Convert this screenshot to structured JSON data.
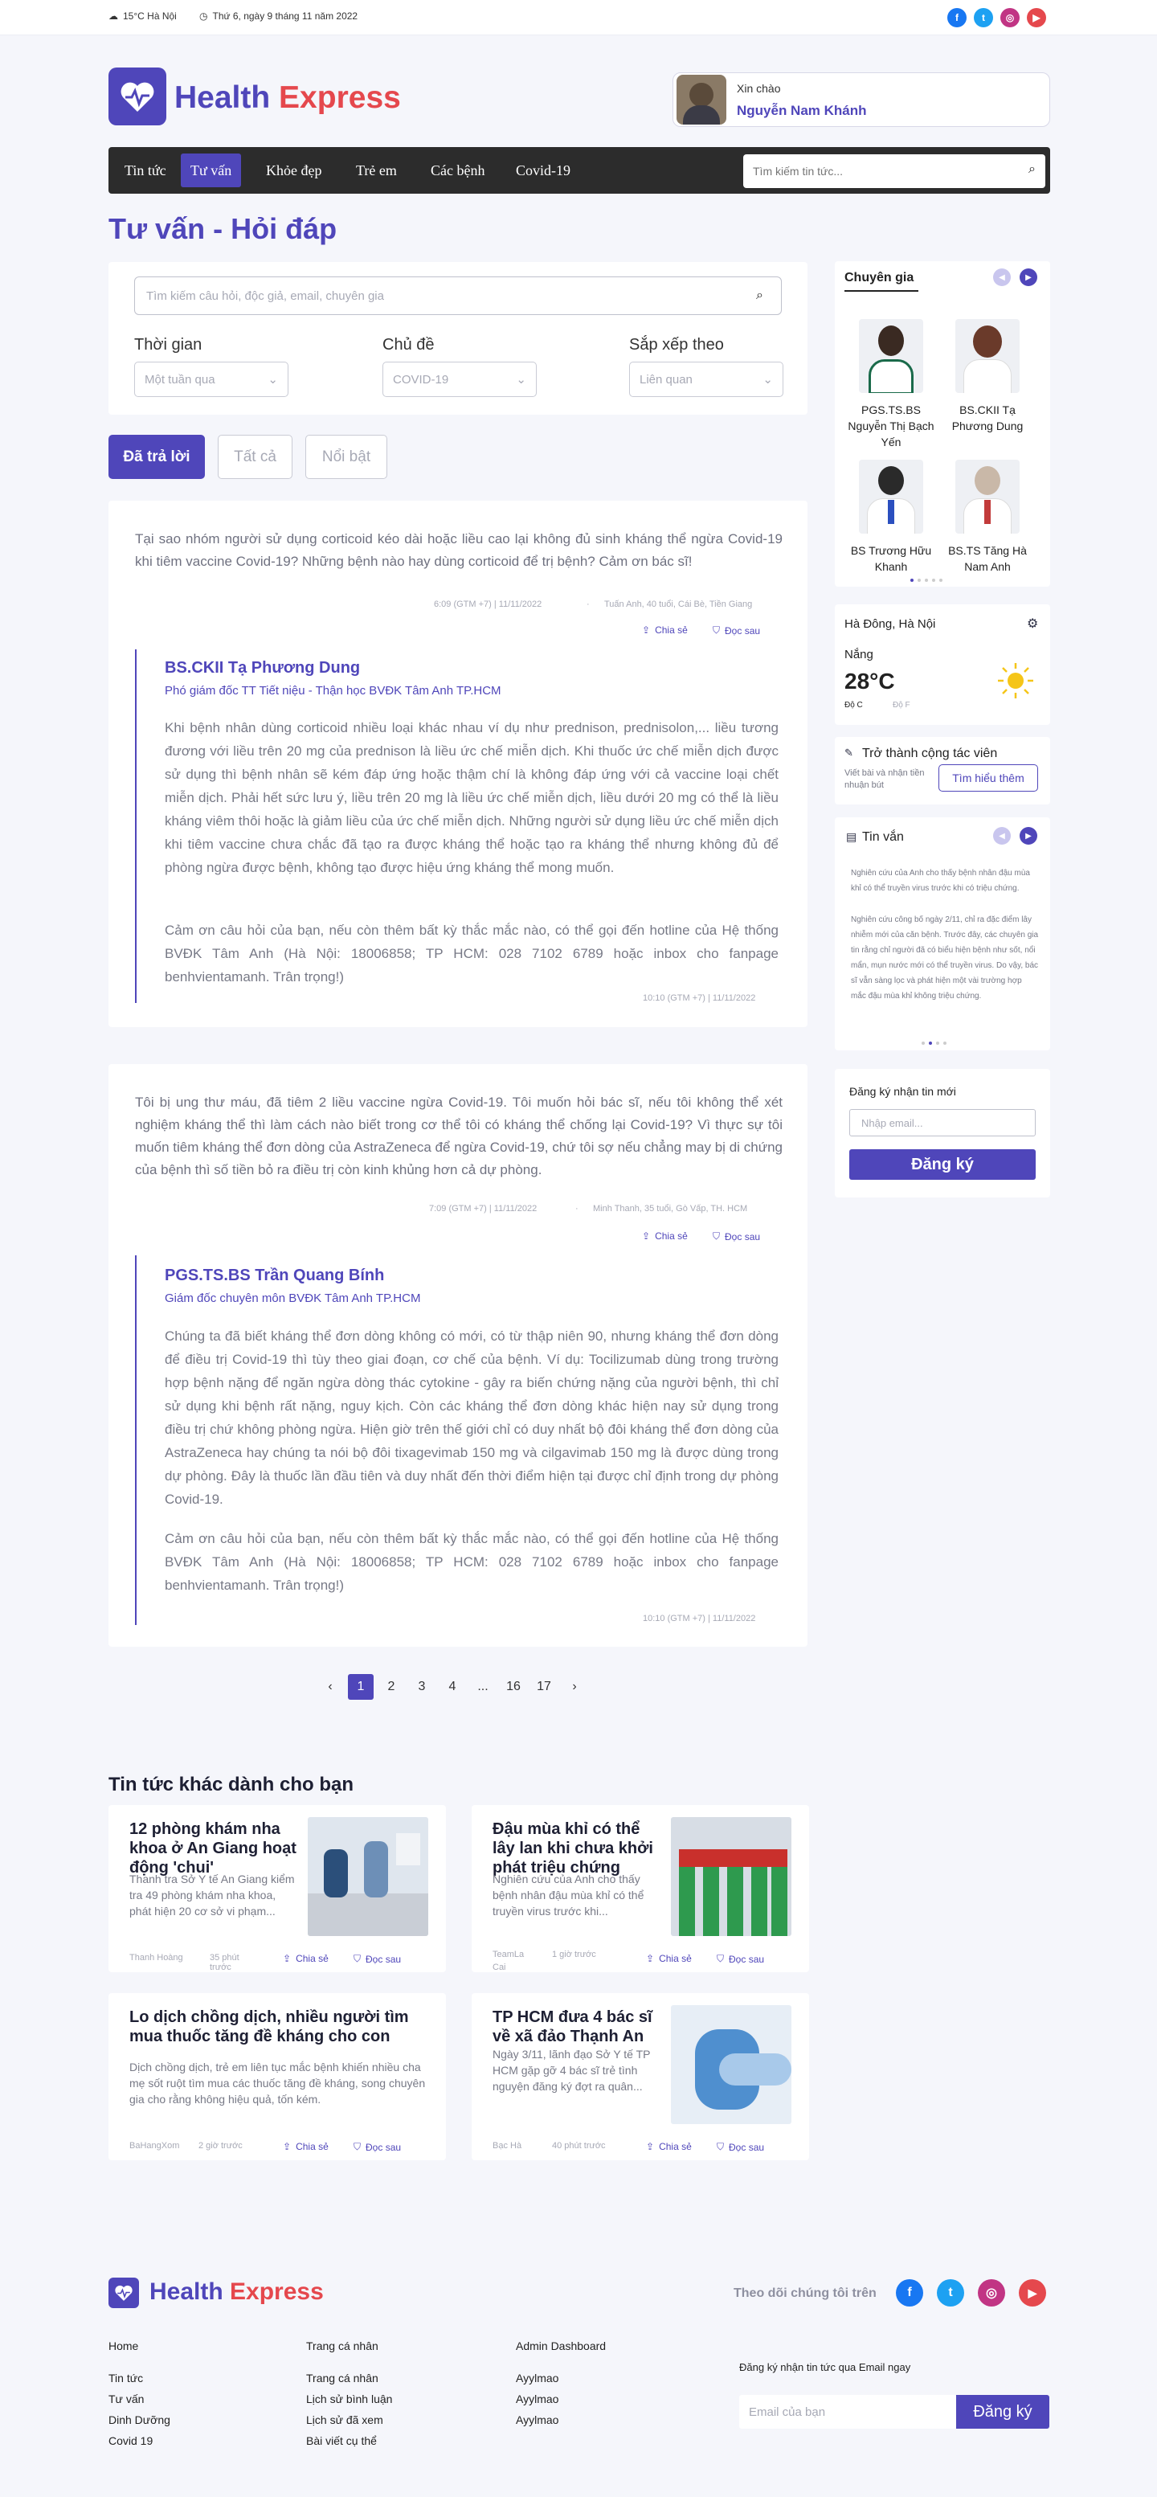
{
  "topbar": {
    "temp": "15°C Hà Nội",
    "date": "Thứ 6, ngày 9 tháng 11 năm 2022",
    "social": [
      "f",
      "t",
      "ig",
      "yt"
    ]
  },
  "brand": {
    "name1": "Health",
    "name2": "Express"
  },
  "greeting": {
    "hello": "Xin chào",
    "user": "Nguyễn Nam Khánh"
  },
  "nav": {
    "items": [
      "Tin tức",
      "Tư vấn",
      "Khỏe đẹp",
      "Trẻ em",
      "Các bệnh",
      "Covid-19"
    ],
    "search_placeholder": "Tìm kiếm tin tức..."
  },
  "page": {
    "title": "Tư vấn - Hỏi đáp"
  },
  "filters": {
    "search_placeholder": "Tìm kiếm câu hỏi, độc giả, email, chuyên gia",
    "time_label": "Thời gian",
    "time_value": "Một tuần qua",
    "topic_label": "Chủ đề",
    "topic_value": "COVID-19",
    "sort_label": "Sắp xếp theo",
    "sort_value": "Liên quan"
  },
  "tabs": [
    "Đã trả lời",
    "Tất cả",
    "Nổi bật"
  ],
  "qa": [
    {
      "question": "Tại sao nhóm người sử dụng corticoid kéo dài hoặc liều cao lại không đủ sinh kháng thể ngừa Covid-19 khi tiêm vaccine Covid-19? Những bệnh nào hay dùng corticoid để trị bệnh? Cảm ơn bác sĩ!",
      "time": "6:09 (GTM +7) | 11/11/2022",
      "asker": "Tuấn Anh, 40 tuổi, Cái Bè, Tiền Giang",
      "share": "Chia sẻ",
      "save": "Đọc sau",
      "doctor": "BS.CKII Tạ Phương Dung",
      "role": "Phó giám đốc TT Tiết niệu - Thận học BVĐK Tâm Anh TP.HCM",
      "answer": "Khi bệnh nhân dùng corticoid nhiều loại khác nhau ví dụ như prednison, prednisolon,... liều tương đương với liều trên 20 mg của prednison là liều ức chế miễn dịch. Khi thuốc ức chế miễn dịch được sử dụng thì bệnh nhân sẽ kém đáp ứng hoặc thậm chí là không đáp ứng với cả vaccine loại chết miễn dịch. Phải hết sức lưu ý, liều trên 20 mg là liều ức chế miễn dịch, liều dưới 20 mg có thể là liều kháng viêm thôi hoặc là giảm liều của ức chế miễn dịch. Những người sử dụng liều ức chế miễn dịch khi tiêm vaccine chưa chắc đã tạo ra được kháng thể hoặc tạo ra kháng thể nhưng không đủ để phòng ngừa được bệnh, không tạo được hiệu ứng kháng thể mong muốn.",
      "thanks": "Cảm ơn câu hỏi của bạn, nếu còn thêm bất kỳ thắc mắc nào, có thể gọi đến hotline của Hệ thống BVĐK Tâm Anh (Hà Nội: 18006858; TP HCM: 028 7102 6789 hoặc inbox cho fanpage benhvientamanh. Trân trọng!)",
      "atime": "10:10 (GTM +7) | 11/11/2022"
    },
    {
      "question": "Tôi bị ung thư máu, đã tiêm 2 liều vaccine ngừa Covid-19. Tôi muốn hỏi bác sĩ, nếu tôi không thể xét nghiệm kháng thể thì làm cách nào biết trong cơ thể tôi có kháng thể chống lại Covid-19? Vì thực sự tôi muốn tiêm kháng thể đơn dòng của AstraZeneca để ngừa Covid-19, chứ tôi sợ nếu chẳng may bị di chứng của bệnh thì số tiền bỏ ra điều trị còn kinh khủng hơn cả dự phòng.",
      "time": "7:09 (GTM +7) | 11/11/2022",
      "asker": "Minh Thanh, 35 tuổi, Gò Vấp, TH. HCM",
      "share": "Chia sẻ",
      "save": "Đọc sau",
      "doctor": "PGS.TS.BS Trần Quang Bính",
      "role": "Giám đốc chuyên môn BVĐK Tâm Anh TP.HCM",
      "answer": "Chúng ta đã biết kháng thể đơn dòng không có mới, có từ thập niên 90, nhưng kháng thể đơn dòng để điều trị Covid-19 thì tùy theo giai đoạn, cơ chế của bệnh. Ví dụ: Tocilizumab dùng trong trường hợp bệnh nặng để ngăn ngừa dòng thác cytokine - gây ra biến chứng nặng của người bệnh, thì chỉ sử dụng khi bệnh rất nặng, nguy kịch. Còn các kháng thể đơn dòng khác hiện nay sử dụng trong điều trị chứ không phòng ngừa. Hiện giờ trên thế giới chỉ có duy nhất bộ đôi kháng thể đơn dòng của AstraZeneca hay chúng ta nói bộ đôi tixagevimab 150 mg và cilgavimab 150 mg là được dùng trong dự phòng. Đây là thuốc lần đầu tiên và duy nhất đến thời điểm hiện tại được chỉ định trong dự phòng Covid-19.",
      "thanks": "Cảm ơn câu hỏi của bạn, nếu còn thêm bất kỳ thắc mắc nào, có thể gọi đến hotline của Hệ thống BVĐK Tâm Anh (Hà Nội: 18006858; TP HCM: 028 7102 6789 hoặc inbox cho fanpage benhvientamanh. Trân trọng!)",
      "atime": "10:10 (GTM +7) | 11/11/2022"
    }
  ],
  "pagination": [
    "‹",
    "1",
    "2",
    "3",
    "4",
    "...",
    "16",
    "17",
    "›"
  ],
  "sidebar": {
    "experts_title": "Chuyên gia",
    "experts": [
      "PGS.TS.BS Nguyễn Thị Bạch Yến",
      "BS.CKII Tạ Phương Dung",
      "BS Trương Hữu Khanh",
      "BS.TS Tăng Hà Nam Anh"
    ],
    "weather_loc": "Hà Đông, Hà Nội",
    "weather_state": "Nắng",
    "weather_temp": "28°C",
    "unit_c": "Độ C",
    "unit_f": "Độ F",
    "collab_title": "Trở thành cộng tác viên",
    "collab_text": "Viết bài và nhận tiền nhuận bút",
    "collab_btn": "Tìm hiểu thêm",
    "tinvan_title": "Tin vắn",
    "tinvan_text": "Nghiên cứu của Anh cho thấy bệnh nhân đậu mùa khỉ có thể truyền virus trước khi có triệu chứng.",
    "tinvan_text2": "Nghiên cứu công bố ngày 2/11, chỉ ra đặc điểm lây nhiễm mới của căn bệnh. Trước đây, các chuyên gia tin rằng chỉ người đã có biểu hiện bệnh như sốt, nổi mẩn, mụn nước mới có thể truyền virus. Do vậy, bác sĩ vẫn sàng lọc và phát hiện một vài trường hợp mắc đậu mùa khỉ không triệu chứng.",
    "sub_title": "Đăng ký nhận tin mới",
    "sub_placeholder": "Nhập email...",
    "sub_btn": "Đăng ký"
  },
  "more": {
    "title": "Tin tức khác dành cho bạn",
    "items": [
      {
        "title": "12 phòng khám nha khoa ở An Giang hoạt động 'chui'",
        "desc": "Thanh tra Sở Y tế An Giang kiểm tra 49 phòng khám nha khoa, phát hiện 20 cơ sở vi phạm...",
        "author": "Thanh Hoàng",
        "time": "35 phút trước"
      },
      {
        "title": "Đậu mùa khỉ có thể lây lan khi chưa khởi phát triệu chứng",
        "desc": "Nghiên cứu của Anh cho thấy bệnh nhân đậu mùa khỉ có thể truyền virus trước khi...",
        "author": "TeamLa Cai",
        "time": "1 giờ trước"
      },
      {
        "title": "Lo dịch chồng dịch, nhiều người tìm mua thuốc tăng đề kháng cho con",
        "desc": "Dịch chồng dịch, trẻ em liên tục mắc bệnh khiến nhiều cha mẹ sốt ruột tìm mua các thuốc tăng đề kháng, song chuyên gia cho rằng không hiệu quả, tốn kém.",
        "author": "BaHangXom",
        "time": "2 giờ trước"
      },
      {
        "title": "TP HCM đưa 4 bác sĩ về xã đảo Thạnh An",
        "desc": "Ngày 3/11, lãnh đạo Sở Y tế TP HCM gặp gỡ 4 bác sĩ trẻ tình nguyện đăng ký đợt ra quân...",
        "author": "Bạc Hà",
        "time": "40 phút trước"
      }
    ],
    "share": "Chia sẻ",
    "save": "Đọc sau"
  },
  "footer": {
    "follow": "Theo dõi chúng tôi trên",
    "cols": [
      [
        "Home",
        "Tin tức",
        "Tư vấn",
        "Dinh Dưỡng",
        "Covid 19"
      ],
      [
        "Trang cá nhân",
        "Trang cá nhân",
        "Lịch sử bình luận",
        "Lịch sử đã xem",
        "Bài viết cụ thể"
      ],
      [
        "Admin Dashboard",
        "Ayylmao",
        "Ayylmao",
        "Ayylmao"
      ]
    ],
    "sub_title": "Đăng ký nhận tin tức qua Email ngay",
    "sub_placeholder": "Email của bạn",
    "sub_btn": "Đăng ký"
  },
  "colors": {
    "primary": "#4f46ba",
    "accent": "#e5484d",
    "facebook": "#1877f2",
    "twitter": "#1da1f2",
    "instagram": "#c13584",
    "youtube": "#e5484d"
  }
}
